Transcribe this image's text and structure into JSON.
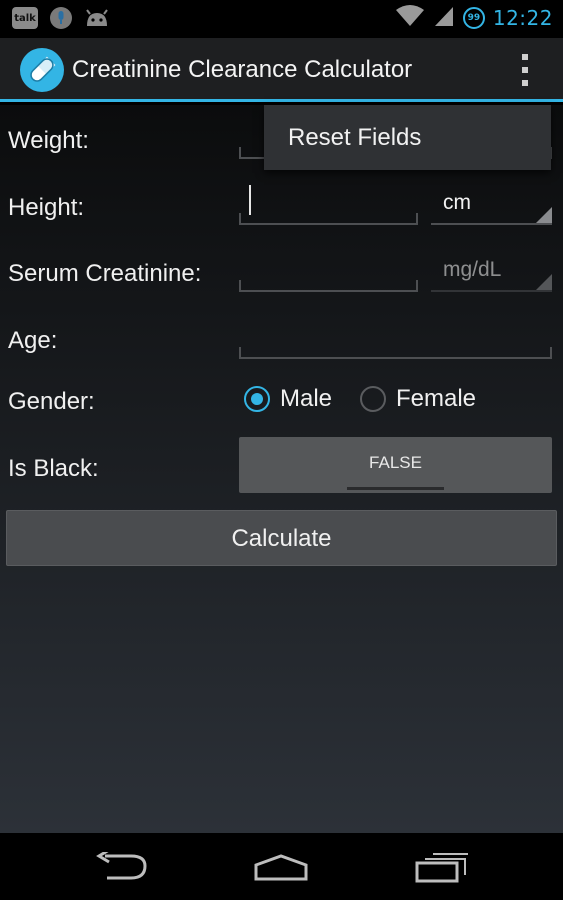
{
  "status_bar": {
    "notifications": [
      "talk-icon",
      "microphone-icon",
      "android-icon"
    ],
    "talk_badge": "talk",
    "battery_level": "99",
    "time": "12:22"
  },
  "action_bar": {
    "title": "Creatinine Clearance Calculator",
    "overflow_icon": "overflow-menu-icon"
  },
  "form": {
    "weight": {
      "label": "Weight:",
      "value": ""
    },
    "height": {
      "label": "Height:",
      "value": "",
      "unit": "cm"
    },
    "serum_creatinine": {
      "label": "Serum Creatinine:",
      "value": "",
      "unit": "mg/dL"
    },
    "age": {
      "label": "Age:",
      "value": ""
    },
    "gender": {
      "label": "Gender:",
      "options": [
        "Male",
        "Female"
      ],
      "selected": "Male"
    },
    "is_black": {
      "label": "Is Black:",
      "value": "FALSE"
    },
    "calculate_label": "Calculate"
  },
  "overflow_menu": {
    "items": [
      {
        "label": "Reset Fields"
      }
    ]
  },
  "nav_bar": {
    "buttons": [
      "back-icon",
      "home-icon",
      "recent-apps-icon"
    ]
  },
  "colors": {
    "accent": "#33b5e5",
    "action_bar_bg": "#1e1f21",
    "button_bg": "#4a4c4f"
  }
}
